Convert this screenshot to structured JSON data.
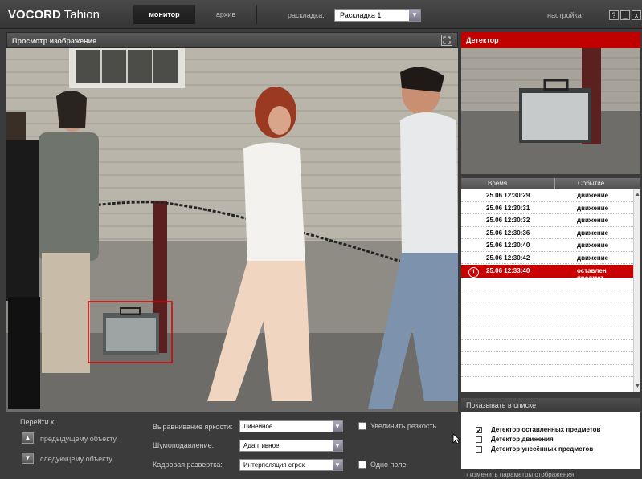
{
  "app": {
    "brand_bold": "VOCORD",
    "brand_light": "Tahion"
  },
  "nav": {
    "monitor": "монитор",
    "archive": "архив",
    "layout_label": "раскладка:",
    "layout_value": "Раскладка 1",
    "settings": "настройка",
    "help": "?",
    "minimize": "_",
    "close": "x"
  },
  "video": {
    "title": "Просмотр изображения"
  },
  "detector": {
    "title": "Детектор"
  },
  "events": {
    "col_time": "Время",
    "col_event": "Событие",
    "rows": [
      {
        "time": "25.06 12:30:29",
        "event": "движение"
      },
      {
        "time": "25.06 12:30:31",
        "event": "движение"
      },
      {
        "time": "25.06 12:30:32",
        "event": "движение"
      },
      {
        "time": "25.06 12:30:36",
        "event": "движение"
      },
      {
        "time": "25.06 12:30:40",
        "event": "движение"
      },
      {
        "time": "25.06 12:30:42",
        "event": "движение"
      },
      {
        "time": "25.06 12:33:40",
        "event": "оставлен предмет"
      }
    ],
    "alert_icon": "!"
  },
  "show_list": {
    "title": "Показывать в списке",
    "items": [
      {
        "label": "Детектор оставленных предметов",
        "checked": true
      },
      {
        "label": "Детектор движения",
        "checked": false
      },
      {
        "label": "Детектор унесённых предметов",
        "checked": false
      }
    ],
    "change_link": "› изменить параметры отображения"
  },
  "controls": {
    "goto_label": "Перейти к:",
    "prev_label": "предыдущему объекту",
    "next_label": "следующему объекту",
    "brightness_label": "Выравнивание яркости:",
    "brightness_value": "Линейное",
    "noise_label": "Шумоподавление:",
    "noise_value": "Адаптивное",
    "scan_label": "Кадровая развертка:",
    "scan_value": "Интерполяция строк",
    "sharpness_label": "Увеличить резкость",
    "single_field_label": "Одно поле"
  },
  "colors": {
    "accent_red": "#c00000",
    "panel_dark": "#3b3b3b"
  }
}
